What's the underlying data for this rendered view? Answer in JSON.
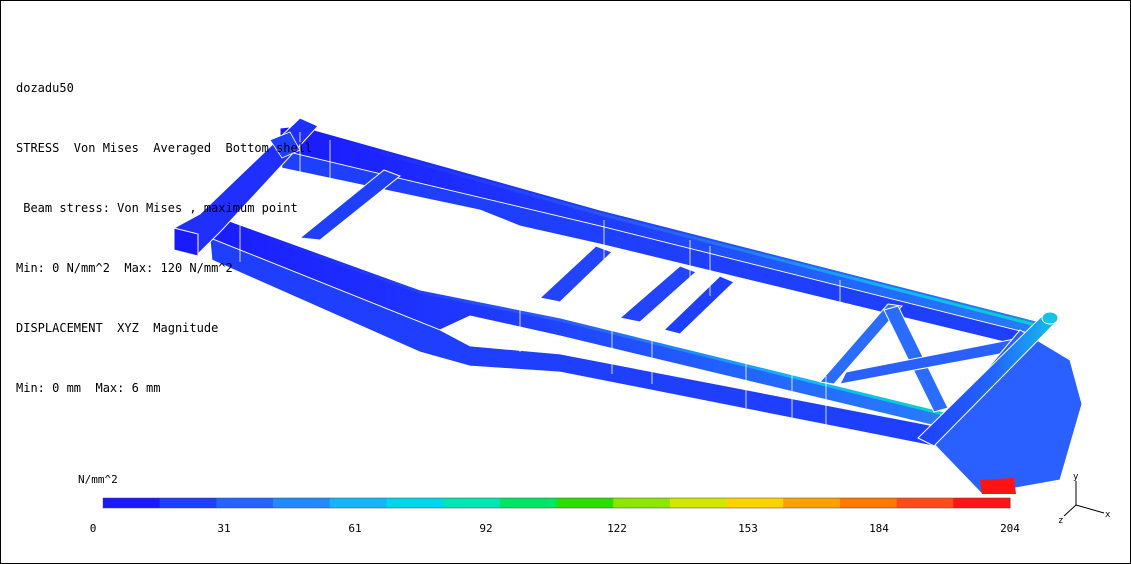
{
  "title_lines": [
    "dozadu50",
    "STRESS  Von Mises  Averaged  Bottom shell",
    " Beam stress: Von Mises , maximum point",
    "Min: 0 N/mm^2  Max: 120 N/mm^2",
    "DISPLACEMENT  XYZ  Magnitude",
    "Min: 0 mm  Max: 6 mm"
  ],
  "legend": {
    "unit": "N/mm^2",
    "tick_labels": [
      "0",
      "31",
      "61",
      "92",
      "122",
      "153",
      "184",
      "204"
    ],
    "colors": [
      "#1a1aff",
      "#1f3fff",
      "#2266ff",
      "#1e8cff",
      "#14b4ff",
      "#00d6f0",
      "#00e6b4",
      "#00e664",
      "#28e000",
      "#8ce600",
      "#d2e600",
      "#ffd200",
      "#ffa000",
      "#ff7800",
      "#ff4b14",
      "#ff1414"
    ]
  },
  "axes": {
    "x": "x",
    "y": "y",
    "z": "z"
  },
  "colors": {
    "low": "#1a1aff",
    "mid_low": "#2266ff",
    "mid": "#14b4ff",
    "high": "#00d6c8",
    "edge": "#ffffff",
    "red_tip": "#ff1414"
  }
}
